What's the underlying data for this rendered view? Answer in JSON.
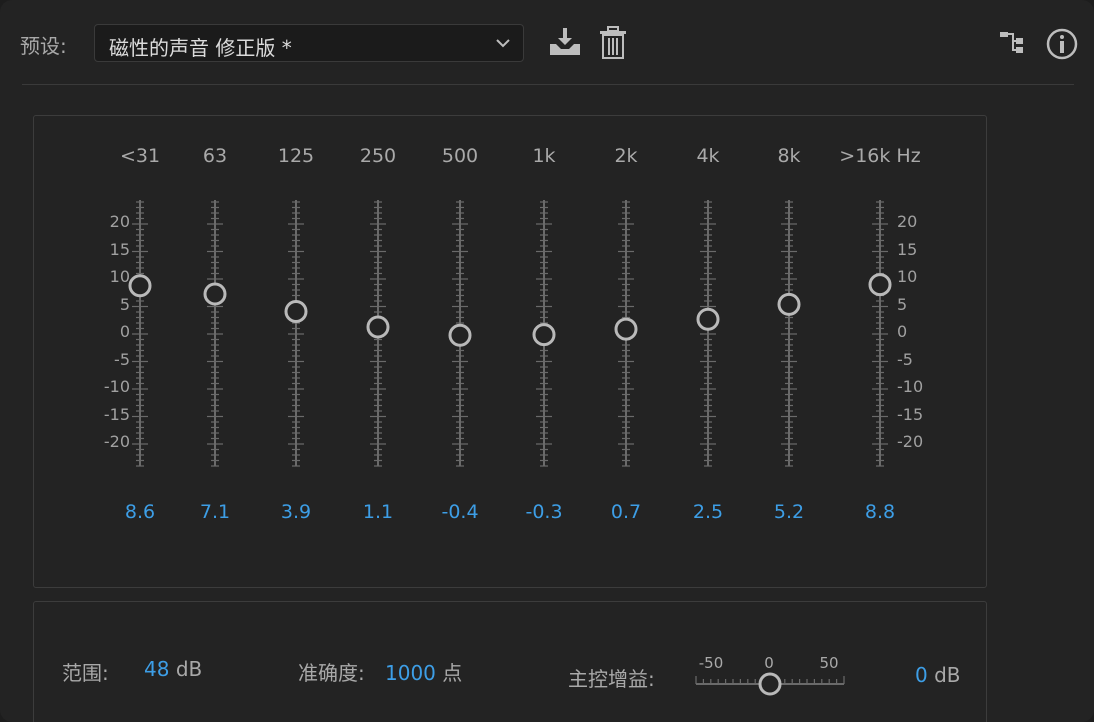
{
  "header": {
    "preset_label": "预设:",
    "preset_value": "磁性的声音 修正版 *"
  },
  "icons": {
    "save": "download-icon",
    "delete": "trash-icon",
    "routing": "routing-icon",
    "info": "info-icon"
  },
  "eq": {
    "bands": [
      {
        "freq": "<31",
        "gain": 8.6,
        "label": "8.6"
      },
      {
        "freq": "63",
        "gain": 7.1,
        "label": "7.1"
      },
      {
        "freq": "125",
        "gain": 3.9,
        "label": "3.9"
      },
      {
        "freq": "250",
        "gain": 1.1,
        "label": "1.1"
      },
      {
        "freq": "500",
        "gain": -0.4,
        "label": "-0.4"
      },
      {
        "freq": "1k",
        "gain": -0.3,
        "label": "-0.3"
      },
      {
        "freq": "2k",
        "gain": 0.7,
        "label": "0.7"
      },
      {
        "freq": "4k",
        "gain": 2.5,
        "label": "2.5"
      },
      {
        "freq": "8k",
        "gain": 5.2,
        "label": "5.2"
      },
      {
        "freq": ">16k Hz",
        "gain": 8.8,
        "label": "8.8"
      }
    ],
    "scale_labels": [
      "20",
      "15",
      "10",
      "5",
      "0",
      "-5",
      "-10",
      "-15",
      "-20"
    ],
    "scale_values": [
      20,
      15,
      10,
      5,
      0,
      -5,
      -10,
      -15,
      -20
    ]
  },
  "footer": {
    "range_label": "范围:",
    "range_value": "48",
    "range_unit": "dB",
    "accuracy_label": "准确度:",
    "accuracy_value": "1000",
    "accuracy_unit": "点",
    "master_gain_label": "主控增益:",
    "master_gain_ticks": [
      "-50",
      "0",
      "50"
    ],
    "master_gain_value": "0",
    "master_gain_unit": "dB",
    "master_gain_level": 0
  },
  "colors": {
    "accent": "#3d9ee6",
    "background": "#232323"
  }
}
